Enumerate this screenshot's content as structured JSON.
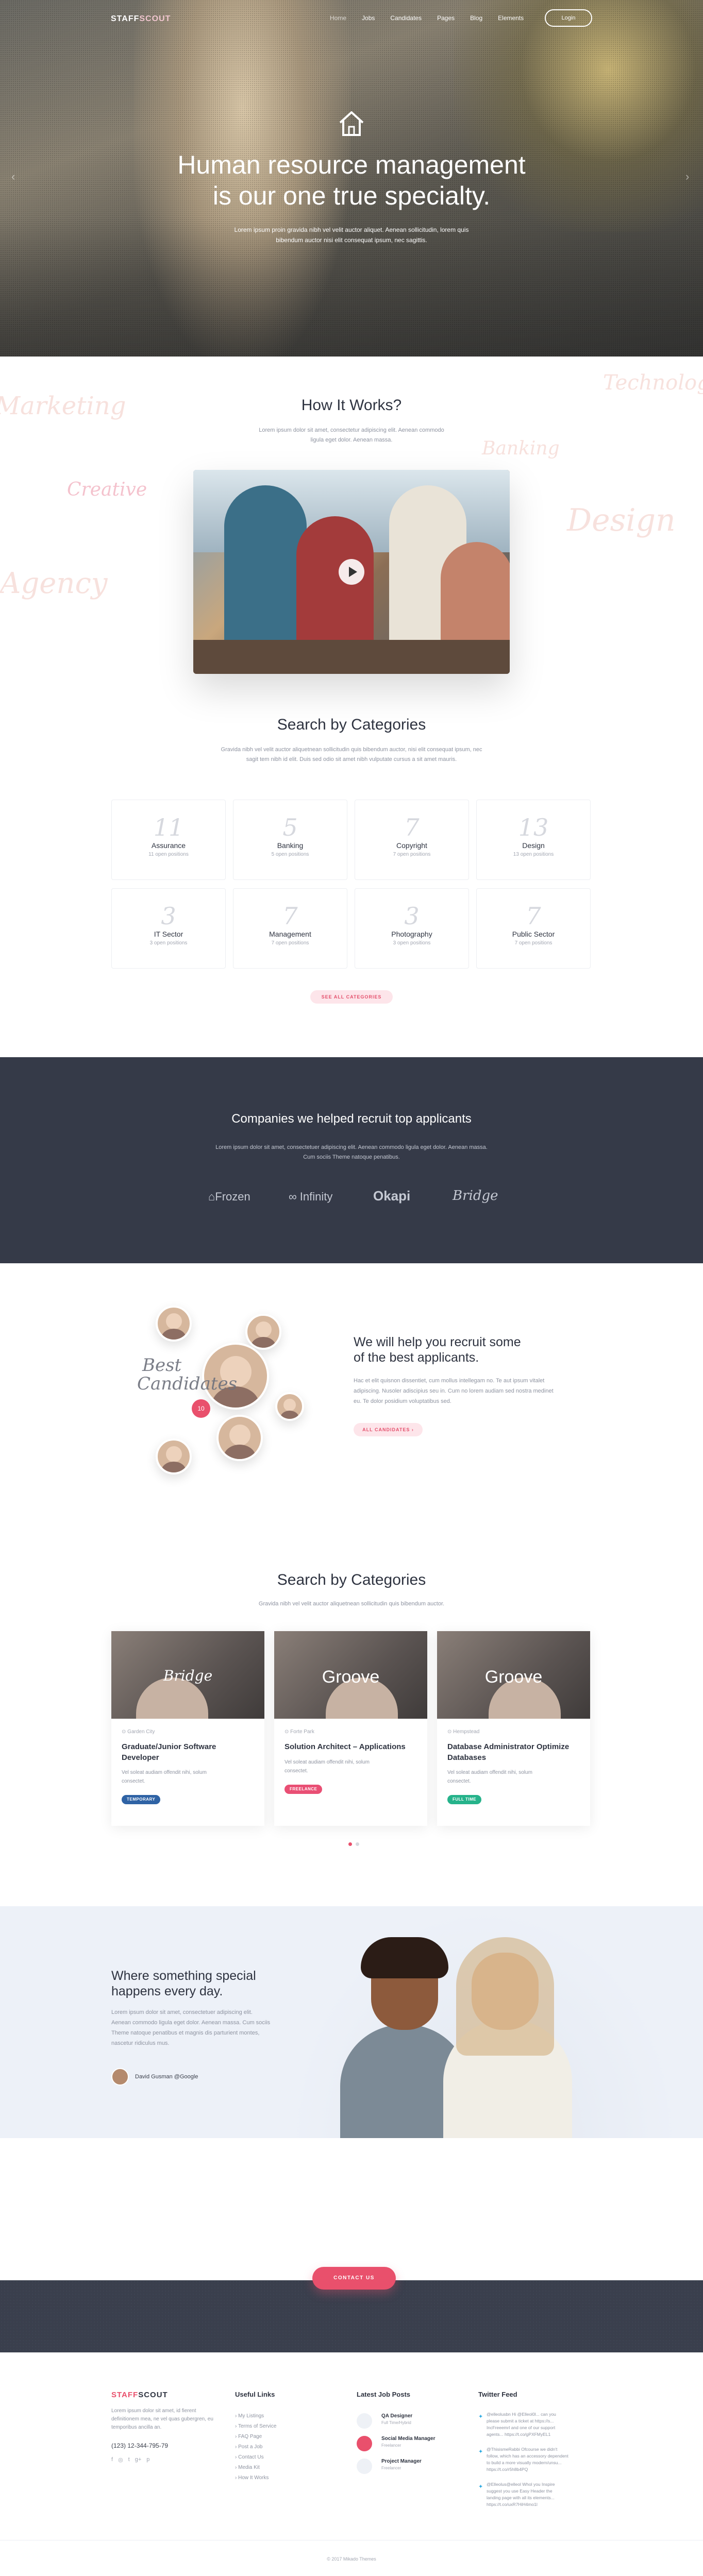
{
  "header": {
    "logo_a": "STAFF",
    "logo_b": "SCOUT",
    "nav": [
      "Home",
      "Jobs",
      "Candidates",
      "Pages",
      "Blog",
      "Elements"
    ],
    "login": "Login"
  },
  "hero": {
    "title_line1": "Human resource management",
    "title_line2": "is our one true specialty.",
    "text_line1": "Lorem ipsum proin gravida nibh vel velit auctor aliquet. Aenean sollicitudin, lorem quis",
    "text_line2": "bibendum auctor nisi elit consequat ipsum, nec sagittis."
  },
  "how": {
    "title": "How It Works?",
    "text_line1": "Lorem ipsum dolor sit amet, consectetur adipiscing elit. Aenean commodo",
    "text_line2": "ligula eget dolor. Aenean massa.",
    "scripts": [
      "Marketing",
      "Technology",
      "Banking",
      "Creative",
      "Design",
      "Agency"
    ]
  },
  "categories": {
    "title": "Search by Categories",
    "text_line1": "Gravida nibh vel velit auctor aliquetnean sollicitudin quis bibendum auctor, nisi elit consequat ipsum, nec",
    "text_line2": "sagit tem nibh id elit. Duis sed odio sit amet nibh vulputate cursus a sit amet mauris.",
    "items": [
      {
        "num": "11",
        "name": "Assurance",
        "positions": "11 open positions"
      },
      {
        "num": "5",
        "name": "Banking",
        "positions": "5 open positions"
      },
      {
        "num": "7",
        "name": "Copyright",
        "positions": "7 open positions"
      },
      {
        "num": "13",
        "name": "Design",
        "positions": "13 open positions"
      },
      {
        "num": "3",
        "name": "IT Sector",
        "positions": "3 open positions"
      },
      {
        "num": "7",
        "name": "Management",
        "positions": "7 open positions"
      },
      {
        "num": "3",
        "name": "Photography",
        "positions": "3 open positions"
      },
      {
        "num": "7",
        "name": "Public Sector",
        "positions": "7 open positions"
      }
    ],
    "see_all": "SEE ALL CATEGORIES"
  },
  "companies": {
    "title": "Companies we helped recruit top applicants",
    "text_line1": "Lorem ipsum dolor sit amet, consectetuer adipiscing elit. Aenean commodo ligula eget dolor. Aenean massa.",
    "text_line2": "Cum sociis Theme natoque penatibus.",
    "brands": [
      "Frozen",
      "Infinity",
      "Okapi",
      "Bridge"
    ]
  },
  "candidates": {
    "script_line1": "Best",
    "script_line2": "Candidates",
    "badge": "10",
    "title_line1": "We will help you recruit some",
    "title_line2": "of the best applicants.",
    "text_line1": "Hac et elit quisnon dissentiet, cum mollus intellegam no. Te aut ipsum vitalet",
    "text_line2": "adipiscing. Nusoler adiscipius seu in. Cum no lorem audiam sed nostra medinet",
    "text_line3": "eu. Te dolor posidium voluptatibus sed.",
    "button": "ALL CANDIDATES"
  },
  "jobs": {
    "title": "Search by Categories",
    "text": "Gravida nibh vel velit auctor aliquetnean sollicitudin quis bibendum auctor.",
    "items": [
      {
        "logo": "Bridge",
        "location": "Garden City",
        "title_line1": "Graduate/Junior Software",
        "title_line2": "Developer",
        "desc_line1": "Vel soleat audiam offendit nihi, solum",
        "desc_line2": "consectet.",
        "tag": "TEMPORARY",
        "tag_color": "#2f63a5"
      },
      {
        "logo": "Groove",
        "location": "Forte Park",
        "title_line1": "Solution Architect – Applications",
        "title_line2": "",
        "desc_line1": "Vel soleat audiam offendit nihi, solum",
        "desc_line2": "consectet.",
        "tag": "FREELANCE",
        "tag_color": "#e94f74"
      },
      {
        "logo": "Groove",
        "location": "Hempstead",
        "title_line1": "Database Administrator Optimize",
        "title_line2": "Databases",
        "desc_line1": "Vel soleat audiam offendit nihi, solum",
        "desc_line2": "consectet.",
        "tag": "FULL TIME",
        "tag_color": "#26b38b"
      }
    ]
  },
  "special": {
    "title_line1": "Where something special",
    "title_line2": "happens every day.",
    "text_line1": "Lorem ipsum dolor sit amet, consectetuer adipiscing elit.",
    "text_line2": "Aenean commodo ligula eget dolor. Aenean massa. Cum sociis",
    "text_line3": "Theme natoque penatibus et magnis dis parturient montes,",
    "text_line4": "nascetur ridiculus mus.",
    "author": "David Gusman @Google"
  },
  "contact": {
    "button": "CONTACT US"
  },
  "footer": {
    "about_line1": "Lorem ipsum dolor sit amet, id fierent",
    "about_line2": "definitionem mea, ne vel quas gubergren, eu",
    "about_line3": "temporibus ancilla an.",
    "phone": "(123) 12-344-795-79",
    "useful_title": "Useful Links",
    "useful_links": [
      "My Listings",
      "Terms of Service",
      "FAQ Page",
      "Post a Job",
      "Contact Us",
      "Media Kit",
      "How It Works"
    ],
    "jobs_title": "Latest Job Posts",
    "job_posts": [
      {
        "title": "QA Designer",
        "sub": "Full Time/Hybrid"
      },
      {
        "title": "Social Media Manager",
        "sub": "Freelancer"
      },
      {
        "title": "Project Manager",
        "sub": "Freelancer"
      }
    ],
    "twitter_title": "Twitter Feed",
    "tweets": [
      {
        "l1": "@elleolusbn Hi @Elleol0l... can you",
        "l2": "please submit a ticket at https://s...",
        "l3": "IncFreeemrl and one of our support",
        "l4": "agents... https://t.co/gPXFMyEL1"
      },
      {
        "l1": "@ThisismeRabbi Ofcourse we didn't",
        "l2": "follow, which has an accessory dependent",
        "l3": "to build a more visually modern/unsu...",
        "l4": "https://t.co/r5h8b4PQ"
      },
      {
        "l1": "@Elleolus@elleol Whol you Inspire",
        "l2": "suggest you use Easy Header the",
        "l3": "landing page with all its elements...",
        "l4": "https://t.co/uxR7HiH4mo1l"
      }
    ],
    "copyright": "© 2017 Mikado Themes"
  }
}
